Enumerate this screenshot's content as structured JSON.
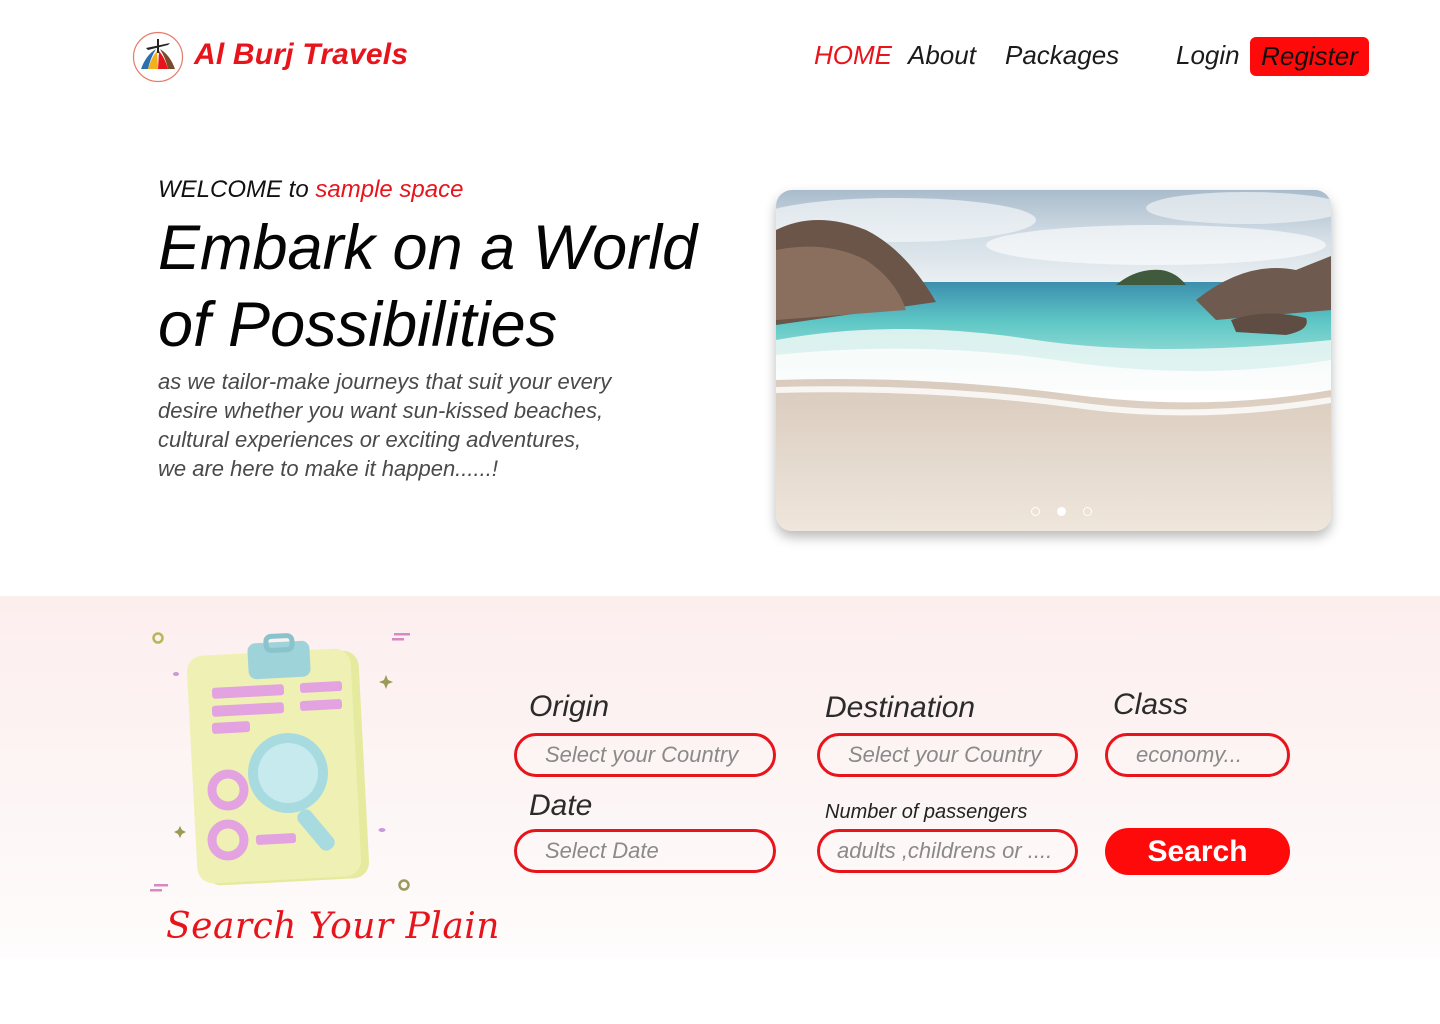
{
  "header": {
    "brand": "Al Burj Travels",
    "nav": {
      "home": "HOME",
      "about": "About",
      "packages": "Packages"
    },
    "login": "Login",
    "register": "Register"
  },
  "hero": {
    "welcome_prefix": "WELCOME to",
    "welcome_accent": "sample space",
    "title": "Embark on a World of Possibilities",
    "subtitle": "as we tailor-make journeys that suit your every\ndesire whether you want sun-kissed beaches,\ncultural experiences or exciting adventures,\nwe are here to make it happen......!",
    "slider": {
      "slides": 3,
      "active_index": 1
    }
  },
  "search": {
    "caption": "Search Your Plain",
    "origin": {
      "label": "Origin",
      "placeholder": "Select your Country"
    },
    "destination": {
      "label": "Destination",
      "placeholder": "Select your Country"
    },
    "class": {
      "label": "Class",
      "placeholder": "economy..."
    },
    "date": {
      "label": "Date",
      "placeholder": "Select Date"
    },
    "passengers": {
      "label": "Number of  passengers",
      "placeholder": "adults ,childrens or ...."
    },
    "button": "Search"
  },
  "colors": {
    "accent": "#e8141b",
    "button": "#ff0a0a",
    "band": "#fdeeee"
  },
  "icons": [
    "logo-icon",
    "clipboard-search-illustration"
  ]
}
